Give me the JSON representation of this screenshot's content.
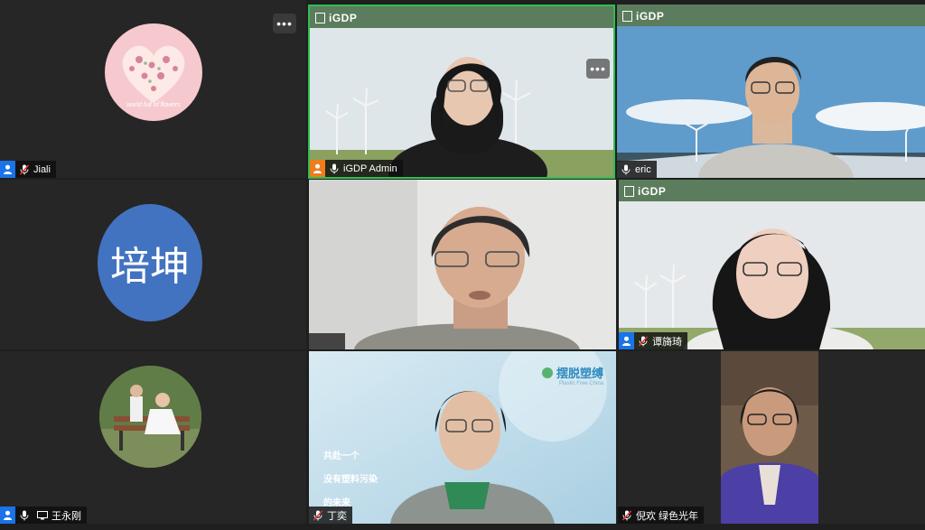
{
  "tiles": {
    "jiali": {
      "name": "Jiali",
      "avatar_text": "world full of flowers"
    },
    "igdp_admin": {
      "name": "iGDP Admin",
      "logo": "iGDP"
    },
    "eric": {
      "name": "eric",
      "logo": "iGDP"
    },
    "peikun": {
      "avatar_text": "培坤"
    },
    "tan": {
      "name": "谭旖琦",
      "logo": "iGDP"
    },
    "wang": {
      "name": "王永刚"
    },
    "ding": {
      "name": "丁奕",
      "brand": "摆脱塑缚",
      "brand_sub": "Plastic Free China",
      "lines": [
        "共赴一个",
        "没有塑料污染",
        "的未来"
      ]
    },
    "ni": {
      "name": "倪欢 绿色光年"
    }
  },
  "more_label": "•••",
  "colors": {
    "host_blue": "#1a73e8",
    "host_orange": "#f07c1c",
    "active_border": "#2fbf4f",
    "peikun_circle": "#4273c0"
  }
}
